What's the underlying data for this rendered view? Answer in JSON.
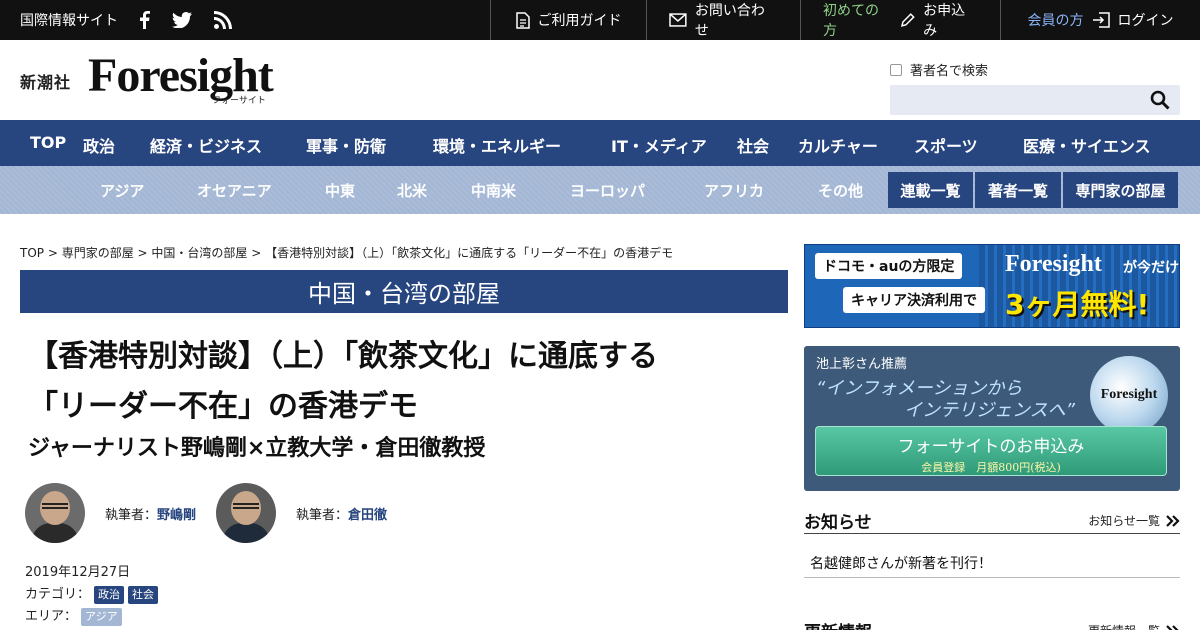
{
  "topbar": {
    "site_label": "国際情報サイト",
    "social_icons": [
      "facebook-icon",
      "twitter-icon",
      "rss-icon"
    ],
    "guide": "ご利用ガイド",
    "contact": "お問い合わせ",
    "first_prefix": "初めての方",
    "apply": "お申込み",
    "member_prefix": "会員の方",
    "login": "ログイン"
  },
  "header": {
    "publisher": "新潮社",
    "logo": "Foresight",
    "logo_sub": "フォーサイト",
    "search_check_label": "著者名で検索",
    "search_value": ""
  },
  "nav_main": [
    "TOP",
    "政治",
    "経済・ビジネス",
    "軍事・防衛",
    "環境・エネルギー",
    "IT・メディア",
    "社会",
    "カルチャー",
    "スポーツ",
    "医療・サイエンス"
  ],
  "nav_sub": [
    "アジア",
    "オセアニア",
    "中東",
    "北米",
    "中南米",
    "ヨーロッパ",
    "アフリカ",
    "その他"
  ],
  "nav_buttons": [
    "連載一覧",
    "著者一覧",
    "専門家の部屋"
  ],
  "breadcrumb": "TOP > 専門家の部屋 > 中国・台湾の部屋 > 【香港特別対談】（上）「飲茶文化」に通底する「リーダー不在」の香港デモ",
  "room_banner": "中国・台湾の部屋",
  "article": {
    "title_line1": "【香港特別対談】（上）「飲茶文化」に通底する",
    "title_line2": "「リーダー不在」の香港デモ",
    "subtitle": "ジャーナリスト野嶋剛×立教大学・倉田徹教授",
    "author_prefix": "執筆者：",
    "author1": "野嶋剛",
    "author2": "倉田徹",
    "date": "2019年12月27日",
    "category_label": "カテゴリ：",
    "categories": [
      "政治",
      "社会"
    ],
    "area_label": "エリア：",
    "areas": [
      "アジア"
    ]
  },
  "ad1": {
    "line1": "ドコモ・auの方限定",
    "line2": "キャリア決済利用で",
    "brand": "Foresight",
    "brand_suffix": "が今だけ",
    "offer": "3ヶ月無料!"
  },
  "ad2": {
    "recommend": "池上彰さん推薦",
    "quote1": "“インフォメーションから",
    "quote2": "インテリジェンスへ”",
    "globe_label": "Foresight",
    "apply_line1": "フォーサイトのお申込み",
    "apply_line2": "会員登録　月額800円(税込)"
  },
  "notice": {
    "heading": "お知らせ",
    "more": "お知らせ一覧",
    "item": "名越健郎さんが新著を刊行！"
  },
  "updates": {
    "heading": "更新情報",
    "more": "更新情報一覧"
  }
}
